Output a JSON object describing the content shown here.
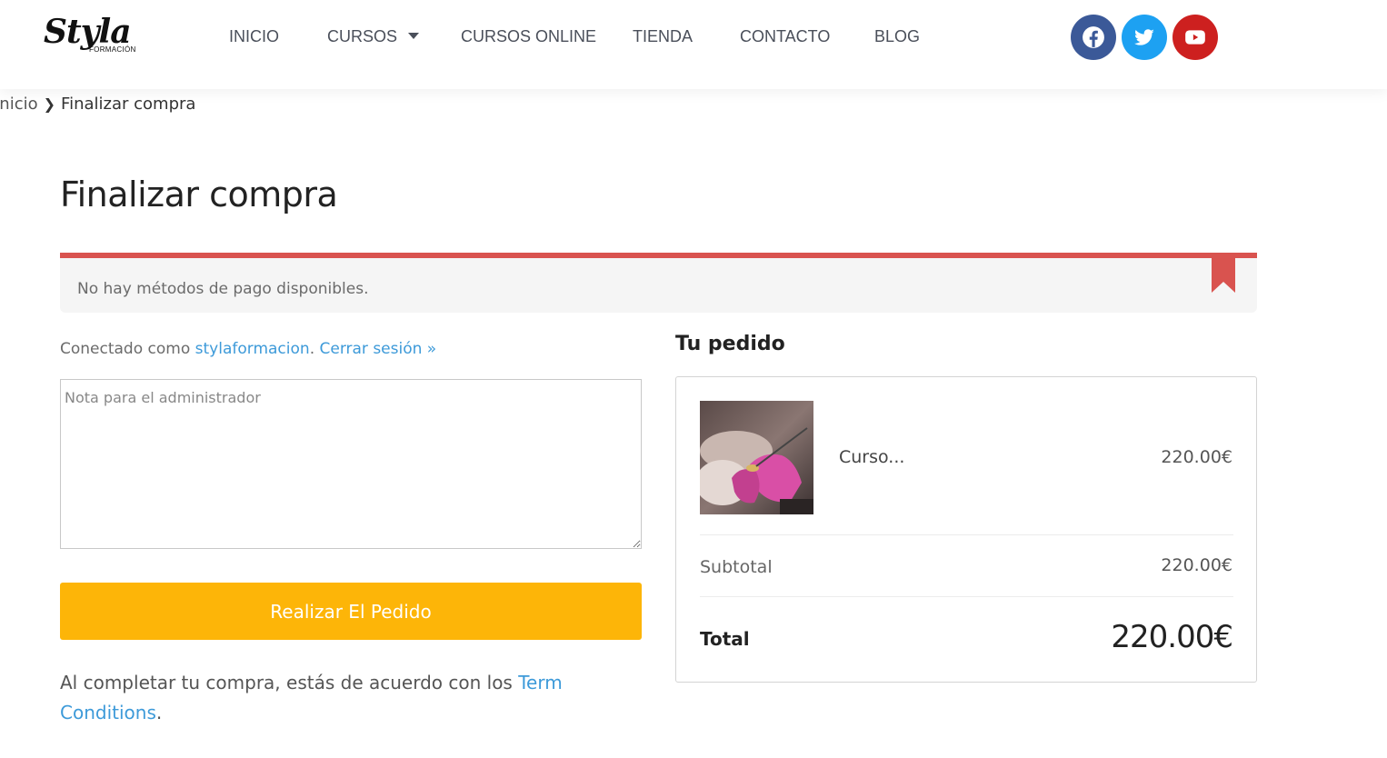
{
  "header": {
    "logo_text": "Styla",
    "logo_sub": "FORMACIÓN",
    "nav": [
      {
        "label": "INICIO"
      },
      {
        "label": "CURSOS"
      },
      {
        "label": "CURSOS ONLINE"
      },
      {
        "label": "TIENDA"
      },
      {
        "label": "CONTACTO"
      },
      {
        "label": "BLOG"
      }
    ],
    "social": [
      {
        "name": "facebook",
        "color": "#3b5998"
      },
      {
        "name": "twitter",
        "color": "#1da1f2"
      },
      {
        "name": "youtube",
        "color": "#cd201f"
      }
    ]
  },
  "breadcrumb": {
    "home": "Inicio",
    "current": "Finalizar compra"
  },
  "page": {
    "title": "Finalizar compra",
    "notice": "No hay métodos de pago disponibles.",
    "notice_color": "#d9534f"
  },
  "account": {
    "prefix": "Conectado como ",
    "username": "stylaformacion",
    "separator": ". ",
    "logout": "Cerrar sesión »"
  },
  "note": {
    "placeholder": "Nota para el administrador"
  },
  "order_button": {
    "label": "Realizar El Pedido",
    "color": "#fdb508"
  },
  "terms": {
    "text": "Al completar tu compra, estás de acuerdo con los ",
    "link": "Term Conditions",
    "end": "."
  },
  "order": {
    "title": "Tu pedido",
    "product": {
      "name": "Curso...",
      "price": "220.00€"
    },
    "subtotal_label": "Subtotal",
    "subtotal_value": "220.00€",
    "total_label": "Total",
    "total_value": "220.00€"
  }
}
